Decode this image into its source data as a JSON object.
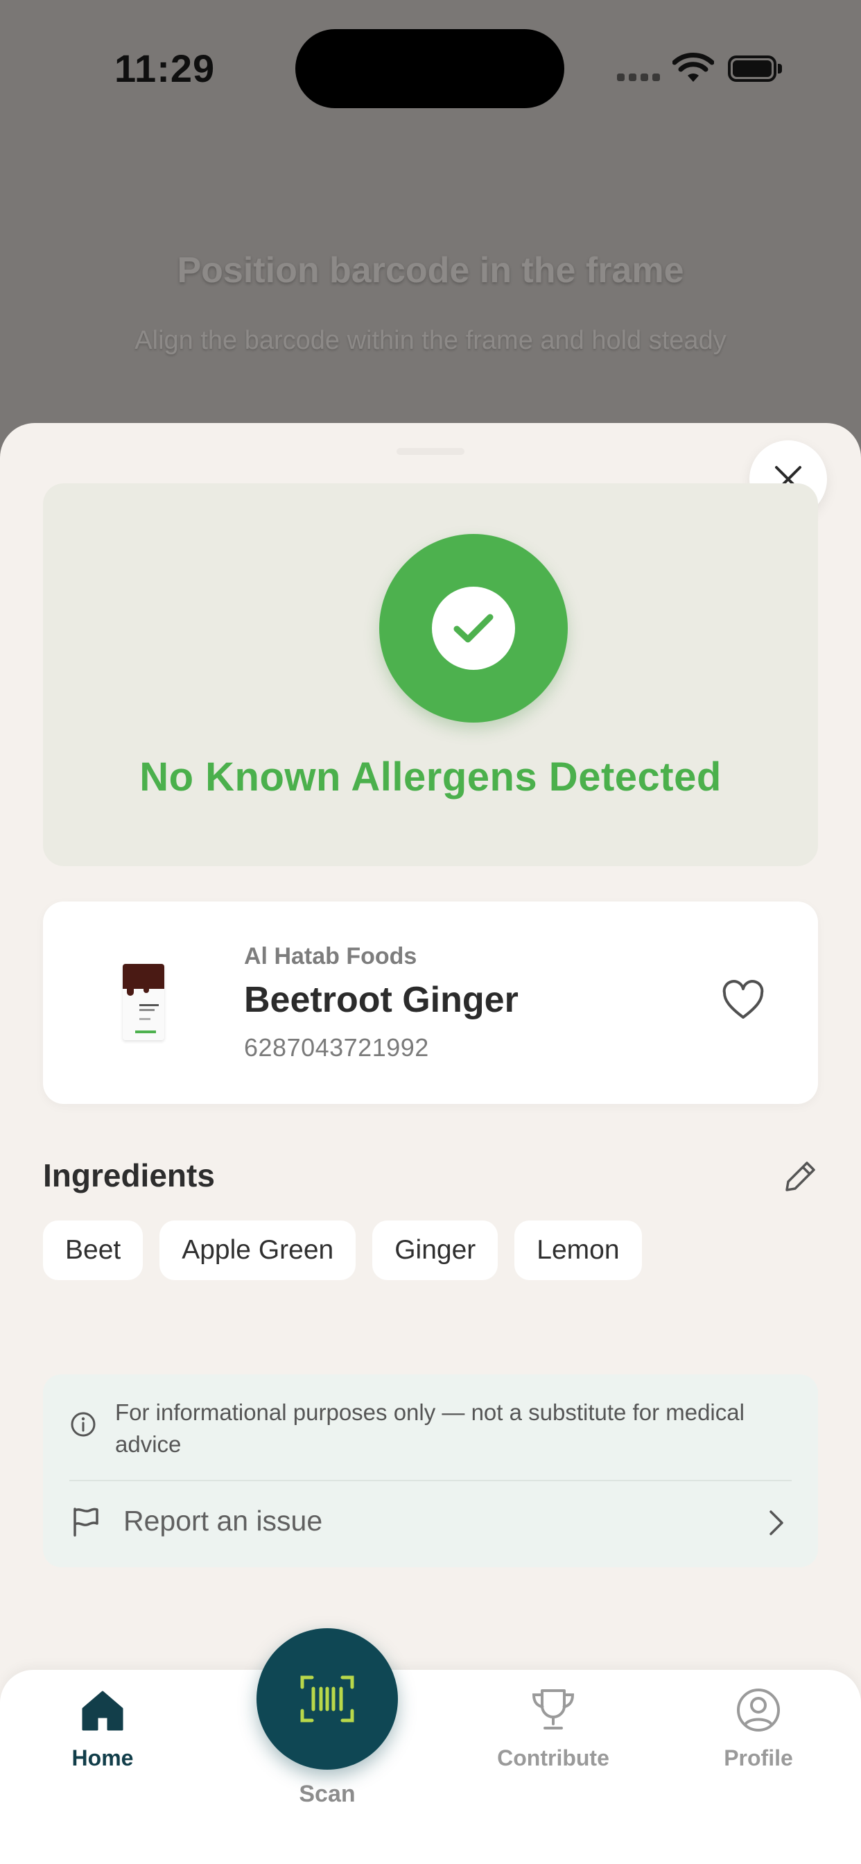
{
  "status_bar": {
    "time": "11:29"
  },
  "scanner": {
    "title": "Position barcode in the frame",
    "subtitle": "Align the barcode within the frame and hold steady"
  },
  "result": {
    "message": "No Known Allergens Detected",
    "status_color": "#4bb04c"
  },
  "product": {
    "brand": "Al Hatab Foods",
    "name": "Beetroot Ginger",
    "barcode": "6287043721992"
  },
  "ingredients": {
    "title": "Ingredients",
    "items": [
      "Beet",
      "Apple Green",
      "Ginger",
      "Lemon"
    ]
  },
  "info": {
    "disclaimer": "For informational purposes only — not a substitute for medical advice",
    "report_label": "Report an issue"
  },
  "tabbar": {
    "home": "Home",
    "scan": "Scan",
    "contribute": "Contribute",
    "profile": "Profile",
    "active_color": "#123e4a",
    "scan_color": "#0f4754"
  },
  "icons": {
    "close": "close-icon",
    "check": "check-icon",
    "favorite": "heart-icon",
    "edit": "pencil-icon",
    "info": "info-icon",
    "report": "flag-icon"
  }
}
